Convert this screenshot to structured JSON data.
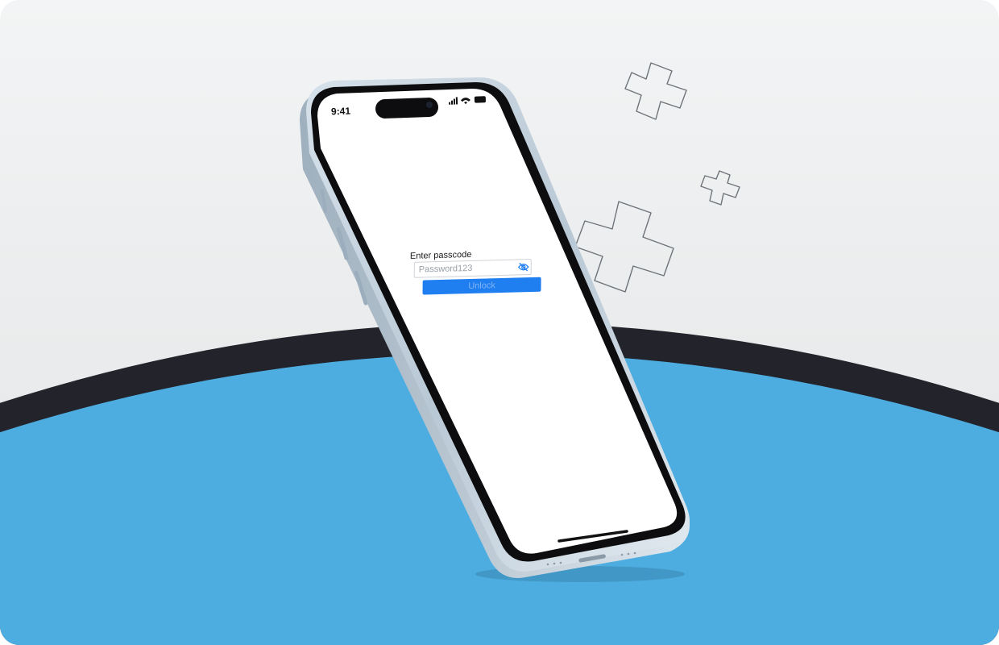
{
  "status_bar": {
    "time": "9:41"
  },
  "lock_screen": {
    "label": "Enter passcode",
    "password_placeholder": "Password123",
    "unlock_label": "Unlock",
    "toggle_icon": "eye-slash-icon"
  },
  "colors": {
    "table_blue": "#4eade0",
    "table_rim": "#23232b",
    "button_blue": "#1f7ef0",
    "background": "#eceeef"
  }
}
